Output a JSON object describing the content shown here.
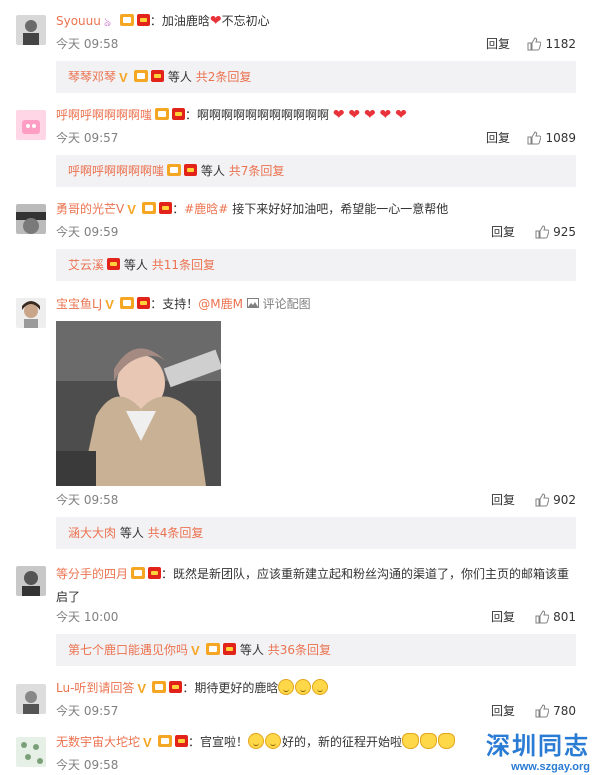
{
  "comments": [
    {
      "name": "Syouuu",
      "text": "：加油鹿晗",
      "text2": "不忘初心",
      "time": "今天 09:58",
      "reply_label": "回复",
      "likes": "1182",
      "sub": {
        "names": "琴琴邓琴",
        "etc": "等人",
        "count": "共2条回复"
      }
    },
    {
      "name": "呼啊呼啊啊啊啊嗤",
      "text": "：啊啊啊啊啊啊啊啊啊啊啊",
      "time": "今天 09:57",
      "reply_label": "回复",
      "likes": "1089",
      "sub": {
        "names": "呼啊呼啊啊啊啊嗤",
        "etc": "等人",
        "count": "共7条回复"
      }
    },
    {
      "name": "勇哥的光芒V",
      "tag": "#鹿晗#",
      "text": "接下来好好加油吧，希望能一心一意帮他",
      "time": "今天 09:59",
      "reply_label": "回复",
      "likes": "925",
      "sub": {
        "names": "艾云溪",
        "etc": "等人",
        "count": "共11条回复"
      }
    },
    {
      "name": "宝宝鱼LJ",
      "text": "：支持！",
      "mention": "@M鹿M",
      "pic_label": "评论配图",
      "time": "今天 09:58",
      "reply_label": "回复",
      "likes": "902",
      "sub": {
        "names": "涵大大肉",
        "etc": "等人",
        "count": "共4条回复"
      }
    },
    {
      "name": "等分手的四月",
      "text": "：既然是新团队，应该重新建立起和粉丝沟通的渠道了，你们主页的邮箱该重启了",
      "time": "今天 10:00",
      "reply_label": "回复",
      "likes": "801",
      "sub": {
        "names": "第七个鹿口能遇见你吗",
        "etc": "等人",
        "count": "共36条回复"
      }
    },
    {
      "name": "Lu-听到请回答",
      "text": "：期待更好的鹿晗",
      "time": "今天 09:57",
      "reply_label": "回复",
      "likes": "780"
    },
    {
      "name": "无数宇宙大坨坨",
      "text": "：官宣啦！",
      "text2": "好的，新的征程开始啦",
      "time": "今天 09:58"
    }
  ],
  "watermark": {
    "title": "深圳同志",
    "url": "www.szgay.org"
  },
  "colors": {
    "name": "#eb7350",
    "meta": "#808080",
    "subbox": "#f2f2f5"
  }
}
